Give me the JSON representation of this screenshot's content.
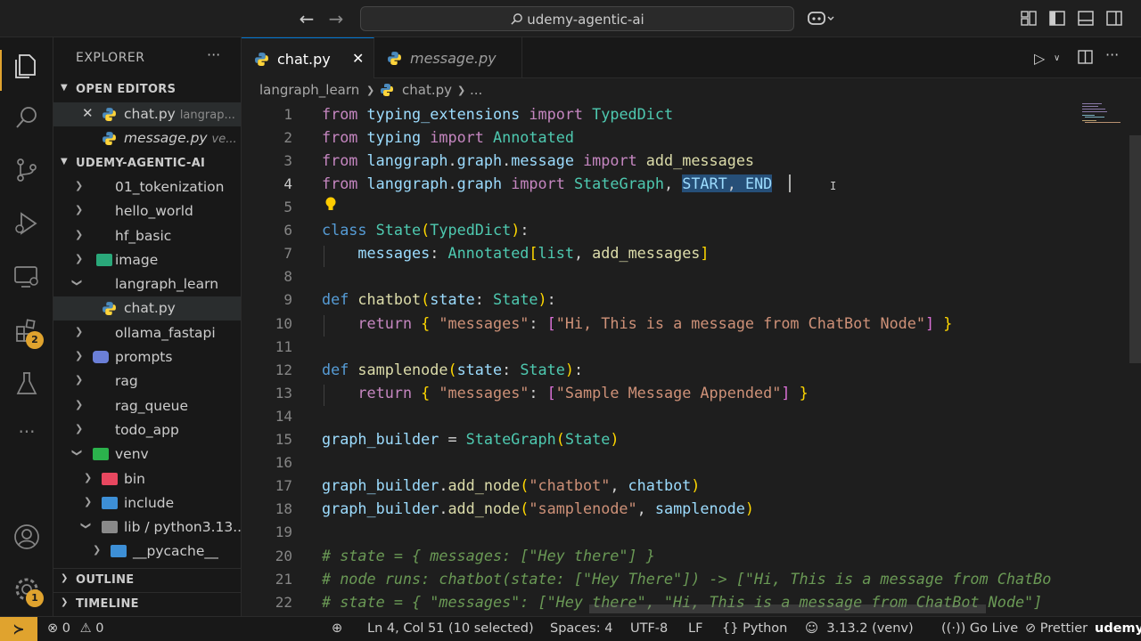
{
  "window": {
    "search_label": "udemy-agentic-ai"
  },
  "activity": {
    "extensions_badge": "2",
    "settings_badge": "1"
  },
  "explorer": {
    "title": "EXPLORER",
    "more": "···",
    "open_editors_label": "OPEN EDITORS",
    "open_editors": [
      {
        "name": "chat.py",
        "desc": "langrap..."
      },
      {
        "name": "message.py",
        "desc": "ve..."
      }
    ],
    "workspace_label": "UDEMY-AGENTIC-AI",
    "tree": [
      {
        "name": "01_tokenization"
      },
      {
        "name": "hello_world"
      },
      {
        "name": "hf_basic"
      },
      {
        "name": "image"
      },
      {
        "name": "langraph_learn"
      },
      {
        "name": "chat.py"
      },
      {
        "name": "ollama_fastapi"
      },
      {
        "name": "prompts"
      },
      {
        "name": "rag"
      },
      {
        "name": "rag_queue"
      },
      {
        "name": "todo_app"
      },
      {
        "name": "venv"
      },
      {
        "name": "bin"
      },
      {
        "name": "include"
      },
      {
        "name": "lib / python3.13..."
      },
      {
        "name": "__pycache__"
      }
    ],
    "outline_label": "OUTLINE",
    "timeline_label": "TIMELINE"
  },
  "tabs": [
    {
      "name": "chat.py",
      "active": true
    },
    {
      "name": "message.py",
      "active": false
    }
  ],
  "breadcrumb": {
    "folder": "langraph_learn",
    "file": "chat.py",
    "more": "..."
  },
  "editor": {
    "line_numbers": [
      "1",
      "2",
      "3",
      "4",
      "5",
      "6",
      "7",
      "8",
      "9",
      "10",
      "11",
      "12",
      "13",
      "14",
      "15",
      "16",
      "17",
      "18",
      "19",
      "20",
      "21",
      "22"
    ],
    "current_line": 4,
    "code_lines": [
      "from typing_extensions import TypedDict",
      "from typing import Annotated",
      "from langgraph.graph.message import add_messages",
      "from langgraph.graph import StateGraph, START, END",
      "",
      "class State(TypedDict):",
      "    messages: Annotated[list, add_messages]",
      "",
      "def chatbot(state: State):",
      "    return { \"messages\": [\"Hi, This is a message from ChatBot Node\"] }",
      "",
      "def samplenode(state: State):",
      "    return { \"messages\": [\"Sample Message Appended\"] }",
      "",
      "graph_builder = StateGraph(State)",
      "",
      "graph_builder.add_node(\"chatbot\", chatbot)",
      "graph_builder.add_node(\"samplenode\", samplenode)",
      "",
      "# state = { messages: [\"Hey there\"] }",
      "# node runs: chatbot(state: [\"Hey There\"]) -> [\"Hi, This is a message from ChatBo",
      "# state = { \"messages\": [\"Hey there\", \"Hi, This is a message from ChatBot Node\"]"
    ]
  },
  "status": {
    "errors": "0",
    "warnings": "0",
    "position": "Ln 4, Col 51 (10 selected)",
    "spaces": "Spaces: 4",
    "encoding": "UTF-8",
    "eol": "LF",
    "language_braces": "{}",
    "language": "Python",
    "interpreter": "3.13.2 (venv)",
    "go_live": "Go Live",
    "prettier": "Prettier",
    "watermark": "udemy"
  },
  "colors": {
    "accent": "#0078d4",
    "badge": "#e0a32e",
    "selection": "#264f78"
  }
}
